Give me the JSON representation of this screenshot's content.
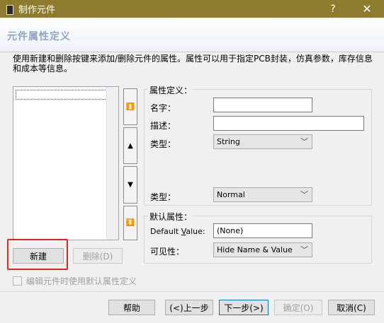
{
  "window": {
    "title": "制作元件",
    "help_glyph": "?",
    "close_glyph": "✕"
  },
  "header": {
    "title": "元件属性定义"
  },
  "description": "使用新建和删除按键来添加/删除元件的属性。属性可以用于指定PCB封装，仿真参数，库存信息和成本等信息。",
  "order_buttons": {
    "top": "⏫",
    "up": "▲",
    "down": "▼",
    "bottom": "⏬"
  },
  "property_definition": {
    "legend": "属性定义：",
    "name_label": "名字：",
    "name_value": "",
    "desc_label": "描述：",
    "desc_value": "",
    "type_label": "类型：",
    "type_value": "String",
    "type2_label": "类型：",
    "type2_value": "Normal"
  },
  "default_attributes": {
    "legend": "默认属性：",
    "default_value_label_pre": "Default ",
    "default_value_label_ul": "V",
    "default_value_label_post": "alue:",
    "default_value": "(None)",
    "visibility_label": "可见性：",
    "visibility_value": "Hide Name & Value"
  },
  "list_buttons": {
    "new": "新建",
    "delete": "删除(D)"
  },
  "checkbox": {
    "label": "编辑元件时使用默认属性定义",
    "checked": false
  },
  "footer": {
    "help": "帮助",
    "back": "(<)上一步",
    "next": "下一步(>)",
    "ok": "确定(O)",
    "cancel": "取消(C)"
  },
  "colors": {
    "titlebar": "#8e7b2e",
    "header_title": "#8ea4c8",
    "highlight": "#e0291c",
    "focus": "#0078d7"
  }
}
